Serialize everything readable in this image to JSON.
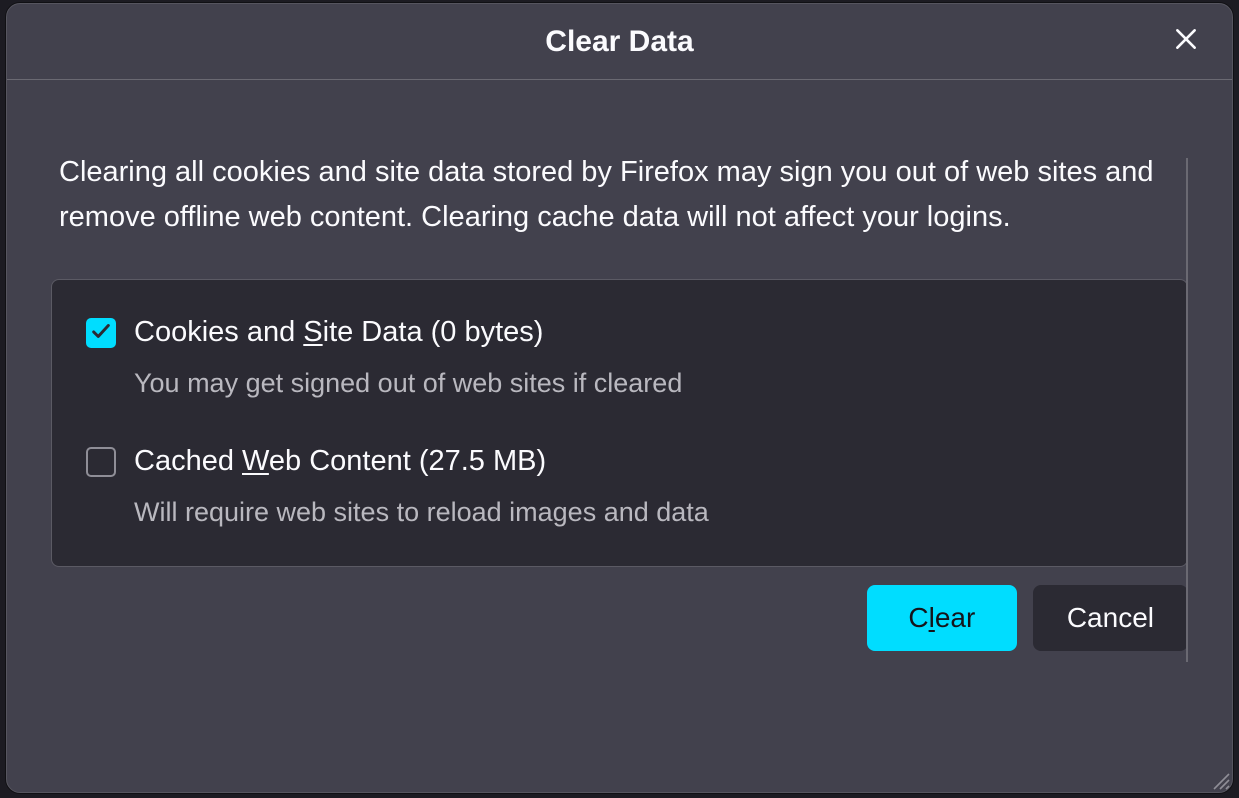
{
  "dialog": {
    "title": "Clear Data",
    "description": "Clearing all cookies and site data stored by Firefox may sign you out of web sites and remove offline web content. Clearing cache data will not affect your logins.",
    "options": [
      {
        "checked": true,
        "label_pre": "Cookies and ",
        "label_ul": "S",
        "label_post": "ite Data (0 bytes)",
        "sub": "You may get signed out of web sites if cleared"
      },
      {
        "checked": false,
        "label_pre": "Cached ",
        "label_ul": "W",
        "label_post": "eb Content (27.5 MB)",
        "sub": "Will require web sites to reload images and data"
      }
    ],
    "buttons": {
      "clear_pre": "C",
      "clear_ul": "l",
      "clear_post": "ear",
      "cancel": "Cancel"
    }
  }
}
